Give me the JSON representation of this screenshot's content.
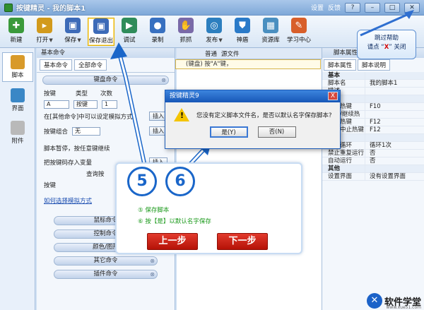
{
  "window": {
    "title": "按键精灵 - 我的脚本1",
    "links": [
      "设置",
      "反馈"
    ],
    "controls": [
      "?",
      "–",
      "□",
      "✕"
    ]
  },
  "toolbar": {
    "items": [
      {
        "label": "新建",
        "color": "#3b9a3b",
        "glyph": "✚"
      },
      {
        "label": "打开",
        "color": "#d29a1c",
        "glyph": "▸",
        "dropdown": "▼"
      },
      {
        "label": "保存",
        "color": "#3d6bb8",
        "glyph": "▣",
        "dropdown": "▼"
      },
      {
        "label": "保存退出",
        "color": "#3d6bb8",
        "glyph": "▣",
        "highlighted": true
      },
      {
        "label": "调试",
        "color": "#2f8c5a",
        "glyph": "▶"
      },
      {
        "label": "录制",
        "color": "#3870c0",
        "glyph": "●"
      },
      {
        "label": "抓抓",
        "color": "#7a6aa8",
        "glyph": "✋"
      },
      {
        "label": "发布",
        "color": "#2d7fbf",
        "glyph": "◎",
        "dropdown": "▼"
      },
      {
        "label": "神盾",
        "color": "#2a7ac8",
        "glyph": "⛊"
      },
      {
        "label": "资源库",
        "color": "#4a8fc0",
        "glyph": "▦"
      },
      {
        "label": "学习中心",
        "color": "#d85f2a",
        "glyph": "✎"
      }
    ]
  },
  "sidebar": {
    "items": [
      {
        "label": "脚本",
        "color": "#d89a2a"
      },
      {
        "label": "界面",
        "color": "#3a87c6"
      },
      {
        "label": "附件",
        "color": "#b9b9b9"
      }
    ]
  },
  "command_panel": {
    "title": "基本命令",
    "tabs": [
      "基本命令",
      "全部命令"
    ],
    "keyboard_section": "键盘命令",
    "key_header": {
      "key": "按键",
      "type": "类型",
      "times": "次数"
    },
    "key_values": {
      "key": "A",
      "type": "按键",
      "times": "1"
    },
    "wait_text": "在[其他命令]中可以设定模拟方式",
    "insert": "插入",
    "combo_label": "按键组合",
    "combo_value": "无",
    "pause_text": "脚本暂停，按任意键继续",
    "store_text": "把按键码存入变量",
    "query_text": "查询按",
    "key_label": "按键",
    "link_text": "如何选择模拟方式",
    "sections": [
      "鼠标命令",
      "控制命令",
      "颜色/图形",
      "其它命令",
      "插件命令"
    ]
  },
  "editor": {
    "tabs": [
      "普通",
      "源文件"
    ],
    "line": "(键盘) 按\"A\"键，"
  },
  "properties": {
    "title": "脚本属性",
    "tabs": [
      "脚本属性",
      "脚本说明"
    ],
    "rows": [
      {
        "k": "基本",
        "v": "",
        "cat": true
      },
      {
        "k": "脚本名",
        "v": "我的脚本1"
      },
      {
        "k": "描述",
        "v": ""
      },
      {
        "k": "热键",
        "v": "",
        "cat": true
      },
      {
        "k": "启动热键",
        "v": "F10"
      },
      {
        "k": "暂停/继续热键",
        "v": ""
      },
      {
        "k": "终止热键",
        "v": "F12"
      },
      {
        "k": "脚本中止热键",
        "v": "F12"
      },
      {
        "k": "运行",
        "v": "",
        "cat": true
      },
      {
        "k": "脚本循环",
        "v": "循环1次"
      },
      {
        "k": "禁止重复运行",
        "v": "否"
      },
      {
        "k": "自动运行",
        "v": "否"
      },
      {
        "k": "其他",
        "v": "",
        "cat": true
      },
      {
        "k": "设置界面",
        "v": "没有设置界面"
      }
    ]
  },
  "callout": {
    "line1": "跳过帮助",
    "line2a": "请点 “",
    "line2b": "X",
    "line2c": "” 关闭"
  },
  "dialog": {
    "title": "按键精灵9",
    "message": "您没有定义脚本文件名，是否以默认名字保存脚本?",
    "yes": "是(Y)",
    "no": "否(N)",
    "close": "X"
  },
  "tutorial": {
    "step5": "⑤ 保存脚本",
    "step6": "⑥ 按【是】以默认名字保存",
    "prev": "上一步",
    "next": "下一步"
  },
  "markers": {
    "five": "5",
    "six": "6"
  },
  "logo": {
    "text": "软件学堂",
    "url": "www.xue51.com"
  }
}
